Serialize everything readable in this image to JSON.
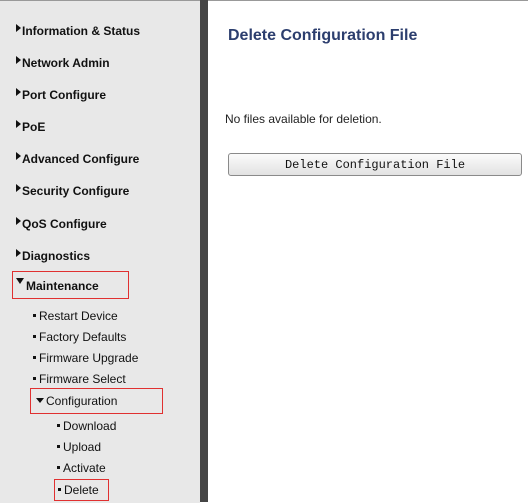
{
  "sidebar": {
    "items": [
      {
        "label": "Information & Status"
      },
      {
        "label": "Network Admin"
      },
      {
        "label": "Port Configure"
      },
      {
        "label": "PoE"
      },
      {
        "label": "Advanced Configure"
      },
      {
        "label": "Security Configure"
      },
      {
        "label": "QoS Configure"
      },
      {
        "label": "Diagnostics"
      },
      {
        "label": "Maintenance"
      }
    ],
    "maintenance_items": [
      {
        "label": "Restart Device"
      },
      {
        "label": "Factory Defaults"
      },
      {
        "label": "Firmware Upgrade"
      },
      {
        "label": "Firmware Select"
      },
      {
        "label": "Configuration"
      }
    ],
    "configuration_items": [
      {
        "label": "Download"
      },
      {
        "label": "Upload"
      },
      {
        "label": "Activate"
      },
      {
        "label": "Delete"
      }
    ]
  },
  "main": {
    "title": "Delete Configuration File",
    "status": "No files available for deletion.",
    "delete_button": "Delete Configuration File"
  },
  "colors": {
    "title": "#2c3e6e",
    "highlight": "#e03030",
    "sidebar_bg": "#e8e8e8",
    "divider": "#454545"
  },
  "icons": {
    "collapsed": "triangle-right-icon",
    "expanded": "triangle-down-icon",
    "bullet": "bullet-icon"
  }
}
